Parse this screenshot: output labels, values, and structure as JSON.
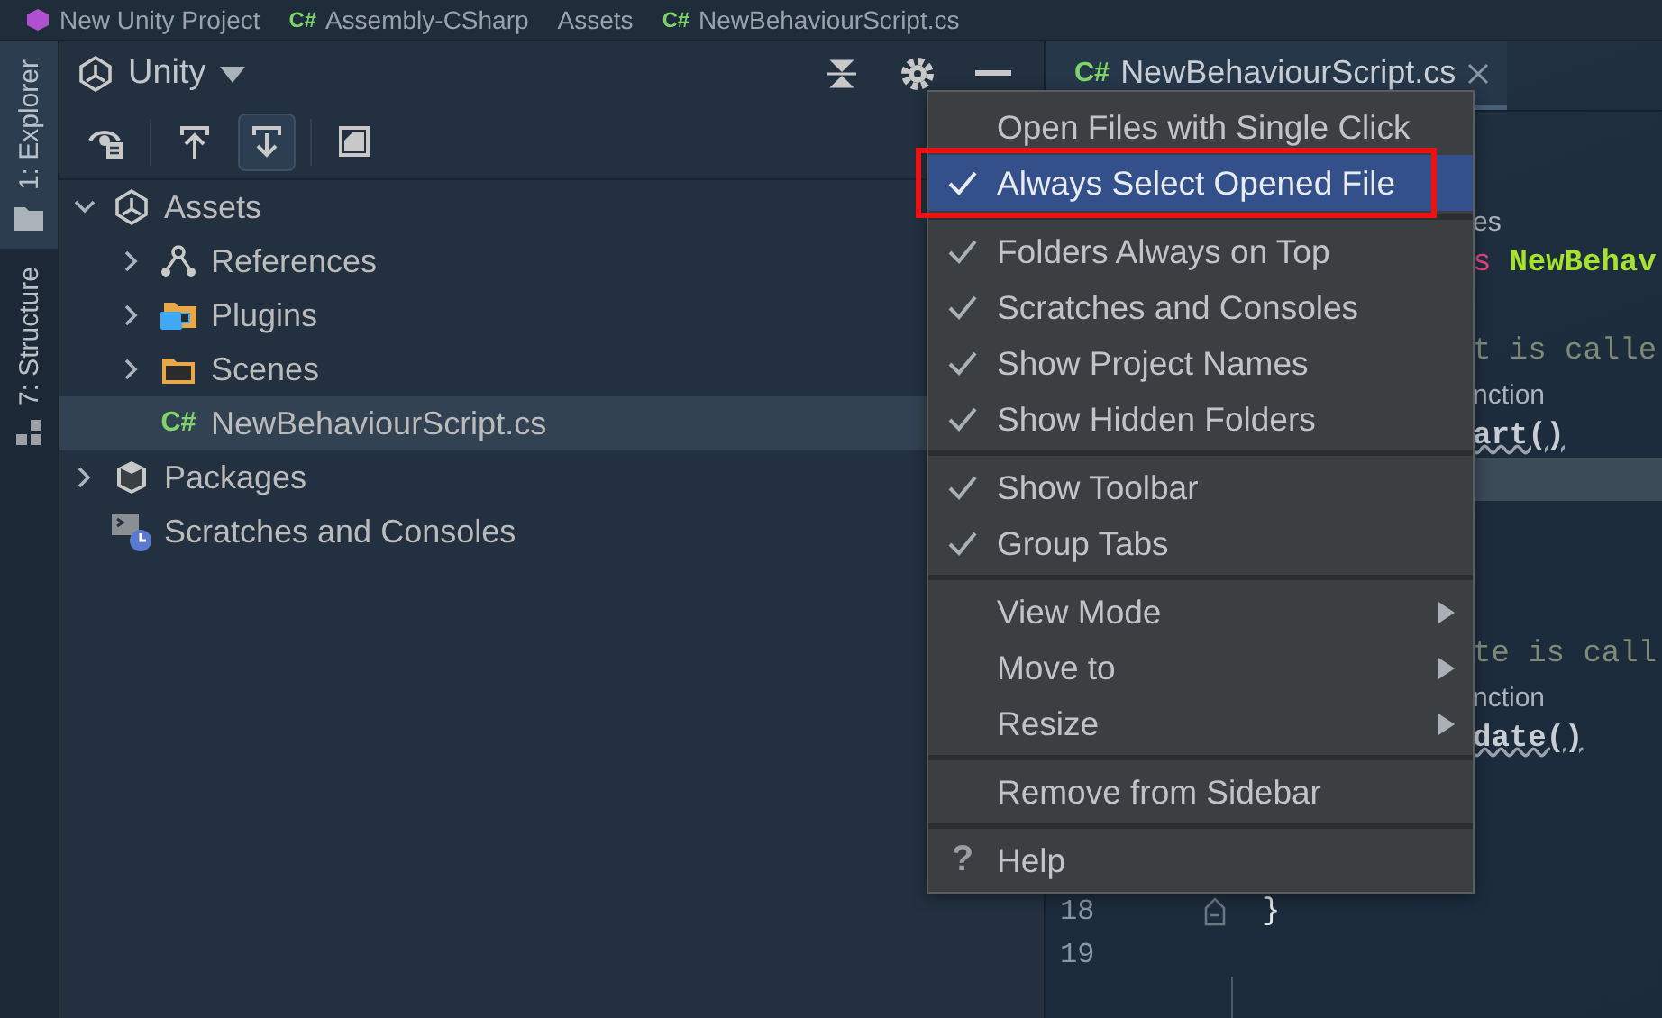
{
  "breadcrumb": [
    {
      "text": "New Unity Project",
      "kind": "project"
    },
    {
      "text": "Assembly-CSharp",
      "kind": "csharp",
      "badge": "C#"
    },
    {
      "text": "Assets",
      "kind": "folder"
    },
    {
      "text": "NewBehaviourScript.cs",
      "kind": "csharp",
      "badge": "C#"
    }
  ],
  "sidebar_tabs": [
    {
      "label": "1: Explorer",
      "kind": "folder",
      "selected": true
    },
    {
      "label": "7: Structure",
      "kind": "structure",
      "selected": false
    }
  ],
  "explorer": {
    "title": "Unity",
    "toolbar": [
      {
        "kind": "show-usages",
        "pressed": false
      },
      {
        "kind": "scroll-from",
        "pressed": false
      },
      {
        "kind": "scroll-to",
        "pressed": true
      },
      {
        "kind": "page",
        "pressed": false
      }
    ],
    "tree": [
      {
        "label": "Assets",
        "kind": "unity",
        "expanded": true,
        "selected": false,
        "children": [
          {
            "label": "References",
            "kind": "references",
            "expanded": false,
            "selected": false
          },
          {
            "label": "Plugins",
            "kind": "plugins",
            "expanded": false,
            "selected": false
          },
          {
            "label": "Scenes",
            "kind": "folder",
            "expanded": false,
            "selected": false
          },
          {
            "label": "NewBehaviourScript.cs",
            "kind": "csharp",
            "badge": "C#",
            "selected": true
          }
        ]
      },
      {
        "label": "Packages",
        "kind": "package",
        "expanded": false,
        "selected": false
      },
      {
        "label": "Scratches and Consoles",
        "kind": "scratches",
        "selected": false
      }
    ]
  },
  "editor": {
    "tab": {
      "label": "NewBehaviourScript.cs",
      "badge": "C#",
      "selected": true
    },
    "lines": [
      {
        "kind": "blank",
        "current": false
      },
      {
        "kind": "blank",
        "current": false
      },
      {
        "kind": "hint",
        "text": "es",
        "current": false
      },
      {
        "kind": "code",
        "current": false,
        "tokens": [
          {
            "text": "s",
            "kind": "keyword",
            "underlined": false
          },
          {
            "text": "NewBehav",
            "kind": "type",
            "underlined": false
          }
        ]
      },
      {
        "kind": "blank",
        "current": false
      },
      {
        "kind": "comment",
        "text": "t is calle",
        "current": false
      },
      {
        "kind": "hint",
        "text": "nction",
        "current": false
      },
      {
        "kind": "code",
        "current": false,
        "tokens": [
          {
            "text": "art()",
            "kind": "method",
            "underlined": true
          }
        ]
      },
      {
        "kind": "blank",
        "current": true
      },
      {
        "kind": "blank",
        "current": false
      },
      {
        "kind": "blank",
        "current": false
      },
      {
        "kind": "blank",
        "current": false
      },
      {
        "kind": "comment",
        "text": "te is call",
        "current": false
      },
      {
        "kind": "hint",
        "text": "nction",
        "current": false
      },
      {
        "kind": "code",
        "current": false,
        "tokens": [
          {
            "text": "date()",
            "kind": "method",
            "underlined": true
          }
        ]
      },
      {
        "kind": "blank",
        "current": false
      },
      {
        "kind": "blank",
        "current": false
      },
      {
        "kind": "blank",
        "current": false
      },
      {
        "kind": "code",
        "number": "18",
        "current": false,
        "tokens": [
          {
            "text": "}",
            "kind": "plain",
            "underlined": false
          }
        ]
      },
      {
        "kind": "blank",
        "number": "19",
        "current": false
      }
    ]
  },
  "menu": {
    "items": [
      {
        "kind": "check",
        "label": "Open Files with Single Click",
        "checked": false,
        "selected": false,
        "annotated": false
      },
      {
        "kind": "check",
        "label": "Always Select Opened File",
        "checked": true,
        "selected": true,
        "annotated": true
      },
      {
        "kind": "separator"
      },
      {
        "kind": "check",
        "label": "Folders Always on Top",
        "checked": true,
        "selected": false,
        "annotated": false
      },
      {
        "kind": "check",
        "label": "Scratches and Consoles",
        "checked": true,
        "selected": false,
        "annotated": false
      },
      {
        "kind": "check",
        "label": "Show Project Names",
        "checked": true,
        "selected": false,
        "annotated": false
      },
      {
        "kind": "check",
        "label": "Show Hidden Folders",
        "checked": true,
        "selected": false,
        "annotated": false
      },
      {
        "kind": "separator"
      },
      {
        "kind": "check",
        "label": "Show Toolbar",
        "checked": true,
        "selected": false,
        "annotated": false
      },
      {
        "kind": "check",
        "label": "Group Tabs",
        "checked": true,
        "selected": false,
        "annotated": false
      },
      {
        "kind": "separator"
      },
      {
        "kind": "submenu",
        "label": "View Mode",
        "selected": false,
        "annotated": false
      },
      {
        "kind": "submenu",
        "label": "Move to",
        "selected": false,
        "annotated": false
      },
      {
        "kind": "submenu",
        "label": "Resize",
        "selected": false,
        "annotated": false
      },
      {
        "kind": "separator"
      },
      {
        "kind": "plain",
        "label": "Remove from Sidebar",
        "selected": false,
        "annotated": false
      },
      {
        "kind": "separator"
      },
      {
        "kind": "help",
        "icon": "?",
        "label": "Help",
        "selected": false,
        "annotated": false
      }
    ]
  }
}
